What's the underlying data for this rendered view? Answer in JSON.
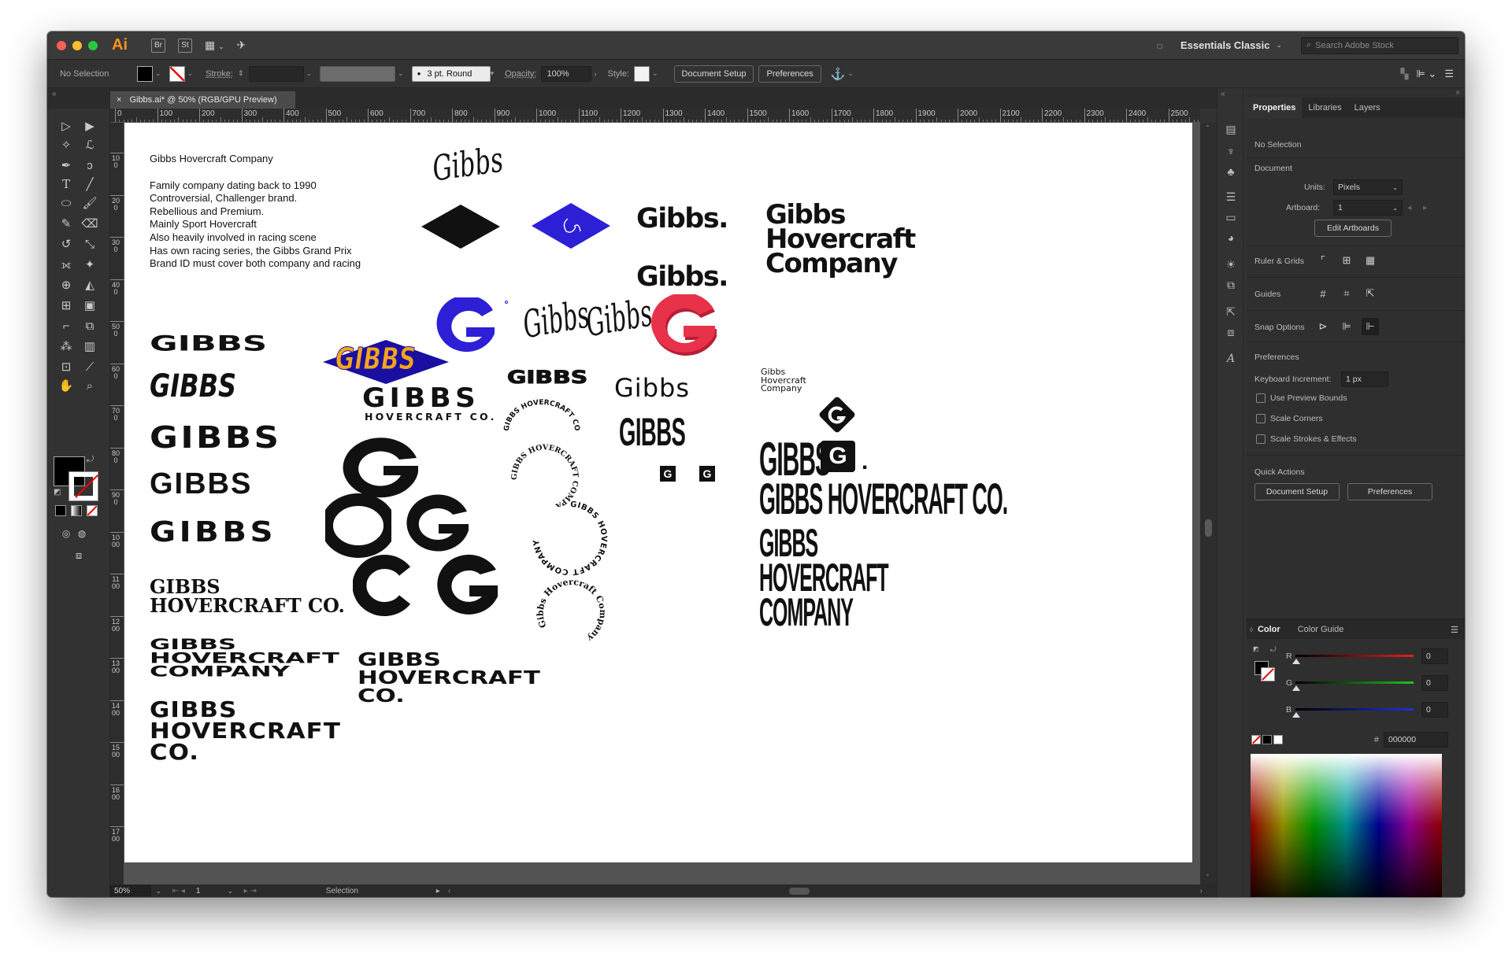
{
  "app": {
    "logo": "Ai",
    "bridge_label": "Br",
    "stock_label": "St",
    "workspace": "Essentials Classic",
    "stock_search_placeholder": "Search Adobe Stock"
  },
  "control_bar": {
    "selection_status": "No Selection",
    "stroke_label": "Stroke:",
    "brush_label": "3 pt. Round",
    "opacity_label": "Opacity:",
    "opacity_value": "100%",
    "style_label": "Style:",
    "document_setup_label": "Document Setup",
    "preferences_label": "Preferences"
  },
  "document_tab": {
    "title": "Gibbs.ai* @ 50% (RGB/GPU Preview)",
    "close_glyph": "×"
  },
  "ruler_top": [
    "0",
    "100",
    "200",
    "300",
    "400",
    "500",
    "600",
    "700",
    "800",
    "900",
    "1000",
    "1100",
    "1200",
    "1300",
    "1400",
    "1500",
    "1600",
    "1700",
    "1800",
    "1900",
    "2000",
    "2100",
    "2200",
    "2300",
    "2400",
    "2500"
  ],
  "ruler_left": [
    "100",
    "200",
    "300",
    "400",
    "500",
    "600",
    "700",
    "800",
    "900",
    "1000",
    "1100",
    "1200",
    "1300",
    "1400",
    "1500",
    "1600",
    "1700"
  ],
  "artboard": {
    "brief_title": "Gibbs Hovercraft Company",
    "brief_lines": [
      "Family company dating back to 1990",
      "Controversial, Challenger brand.",
      "Rebellious and Premium.",
      "Mainly Sport Hovercraft",
      "Also heavily involved in racing scene",
      "Has own racing series, the Gibbs Grand Prix",
      "Brand ID must cover both company and racing"
    ],
    "logos": {
      "script_gibbs": "Gibbs",
      "gibbs_dot_1": "Gibbs.",
      "gibbs_dot_2": "Gibbs.",
      "stacked_line1": "Gibbs",
      "stacked_line2": "Hovercraft",
      "stacked_line3": "Company",
      "gibbs_block_1": "GIBBS",
      "gibbs_italic": "GIBBS",
      "gibbs_wide_1": "GIBBS",
      "gibbs_wide_2": "GIBBS",
      "gibbs_wide_3": "GIBBS",
      "gibbs_diamond": "GIBBS",
      "gibbs_hovercraft_co_main": "GIBBS",
      "gibbs_hovercraft_co_sub": "HOVERCRAFT CO.",
      "gibbs_block_small": "GIBBS",
      "gibbs_rounded": "Gibbs",
      "gibbs_condensed": "GIBBS",
      "small_stack_1": "Gibbs",
      "small_stack_2": "Hovercraft",
      "small_stack_3": "Company",
      "cond_gibbs": "GIBBS",
      "cond_gibbs_g": "G",
      "cond_gibbs_dot": ".",
      "cond_long": "GIBBS HOVERCRAFT CO.",
      "cond_stack_1": "GIBBS",
      "cond_stack_2": "HOVERCRAFT",
      "cond_stack_3": "COMPANY",
      "slab_1": "GIBBS",
      "slab_2": "HOVERCRAFT CO.",
      "blackletter_1": "GIBBS",
      "blackletter_2": "HOVERCRAFT",
      "blackletter_3": "COMPANY",
      "tech_1": "GIBBS",
      "tech_2": "HOVERCRAFT",
      "tech_3": "CO.",
      "bold_stack_1": "GIBBS",
      "bold_stack_2": "HOVERCRAFT",
      "bold_stack_3": "CO.",
      "g_mark": "G",
      "arc_text_1": "GIBBS HOVERCRAFT COMPANY",
      "arc_text_2": "GIBBS HOVERCRAFT COMPANY",
      "circle_text_1": "GIBBS HOVERCRAFT COMPANY",
      "circle_text_2": "Gibbs Hovercraft Company"
    },
    "colors": {
      "blue": "#2c1fd6",
      "navy": "#1a0fa0",
      "orange": "#f7a51c",
      "red": "#e8324a"
    }
  },
  "status_bar": {
    "zoom": "50%",
    "artboard_number": "1",
    "tool": "Selection"
  },
  "properties_panel": {
    "tabs": [
      "Properties",
      "Libraries",
      "Layers"
    ],
    "selection": "No Selection",
    "document_section": "Document",
    "units_label": "Units:",
    "units_value": "Pixels",
    "artboard_label": "Artboard:",
    "artboard_value": "1",
    "edit_artboards": "Edit Artboards",
    "ruler_grids": "Ruler & Grids",
    "guides": "Guides",
    "snap_options": "Snap Options",
    "preferences_section": "Preferences",
    "keyboard_increment_label": "Keyboard Increment:",
    "keyboard_increment_value": "1 px",
    "use_preview_bounds": "Use Preview Bounds",
    "scale_corners": "Scale Corners",
    "scale_strokes": "Scale Strokes & Effects",
    "quick_actions": "Quick Actions",
    "document_setup_button": "Document Setup",
    "preferences_button": "Preferences"
  },
  "color_panel": {
    "tabs": [
      "Color",
      "Color Guide"
    ],
    "channels": [
      {
        "label": "R",
        "value": "0",
        "color": "#e02020"
      },
      {
        "label": "G",
        "value": "0",
        "color": "#20c020"
      },
      {
        "label": "B",
        "value": "0",
        "color": "#2030e0"
      }
    ],
    "hex_label": "#",
    "hex_value": "000000"
  }
}
